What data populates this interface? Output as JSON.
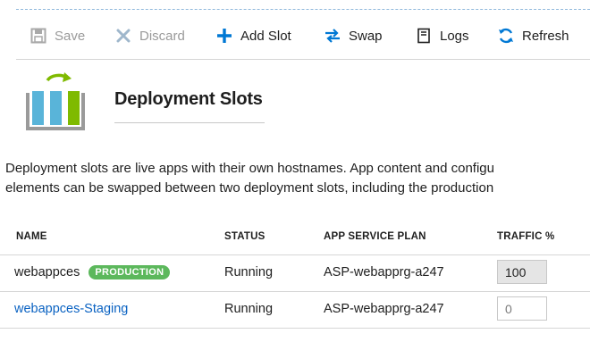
{
  "toolbar": {
    "save": "Save",
    "discard": "Discard",
    "add_slot": "Add Slot",
    "swap": "Swap",
    "logs": "Logs",
    "refresh": "Refresh"
  },
  "blade": {
    "title": "Deployment Slots",
    "description_line1": "Deployment slots are live apps with their own hostnames. App content and configu",
    "description_line2": "elements  can be swapped between two deployment slots, including the production"
  },
  "table": {
    "columns": [
      "NAME",
      "STATUS",
      "APP SERVICE PLAN",
      "TRAFFIC %"
    ],
    "rows": [
      {
        "name": "webappces",
        "badge": "PRODUCTION",
        "status": "Running",
        "plan": "ASP-webapprg-a247",
        "traffic": "100"
      },
      {
        "name": "webappces-Staging",
        "badge": "",
        "status": "Running",
        "plan": "ASP-webapprg-a247",
        "traffic": "0"
      }
    ]
  },
  "colors": {
    "accent_blue": "#0078d4",
    "link": "#0a62c2",
    "badge_green": "#5cb85c",
    "logo_green": "#7fba00",
    "logo_blue": "#59b4d9"
  },
  "icons": [
    "save-icon",
    "discard-icon",
    "add-icon",
    "swap-icon",
    "logs-icon",
    "refresh-icon",
    "deployment-slots-logo"
  ]
}
